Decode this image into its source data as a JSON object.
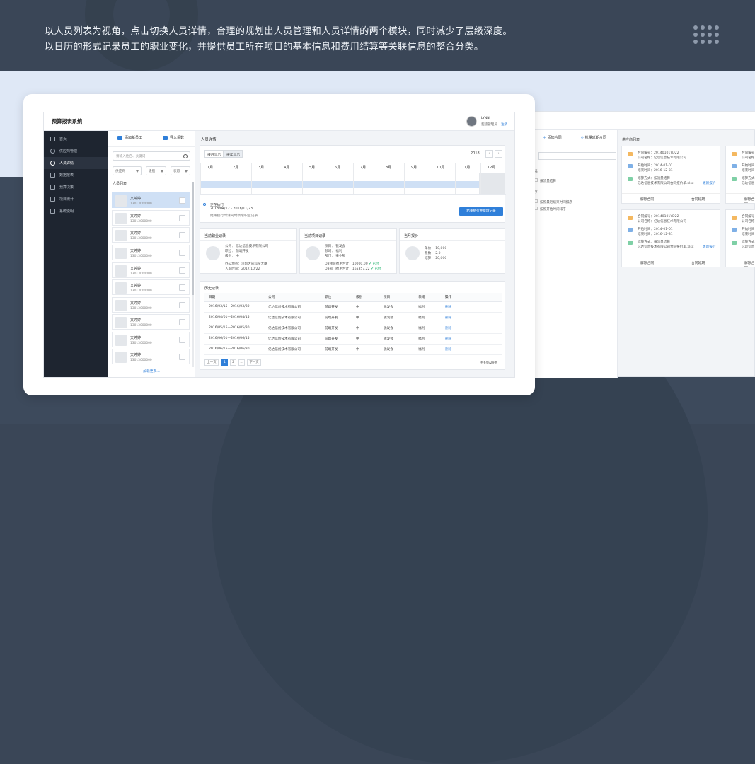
{
  "intro": {
    "line1": "以人员列表为视角，点击切换人员详情，合理的规划出人员管理和人员详情的两个模块，同时减少了层级深度。",
    "line2": "以日历的形式记录员工的职业变化，并提供员工所在项目的基本信息和费用结算等关联信息的整合分类。"
  },
  "colors": {
    "accent": "#2f7fd9",
    "selected_row": "#cfe0f5",
    "sidebar": "#1e2530",
    "band": "#dfe8f6",
    "dark_bg": "#3a4657"
  },
  "app": {
    "title": "预算报表系统",
    "user": {
      "name": "LYNN",
      "role": "超级管理员",
      "link": "注销"
    }
  },
  "sidebar": {
    "items": [
      {
        "label": "首页",
        "icon": "home-icon"
      },
      {
        "label": "供应商管理",
        "icon": "supplier-icon"
      },
      {
        "label": "人员详情",
        "icon": "person-icon"
      },
      {
        "label": "数据报表",
        "icon": "report-icon"
      },
      {
        "label": "预算决策",
        "icon": "budget-icon"
      },
      {
        "label": "项目统计",
        "icon": "project-icon"
      },
      {
        "label": "系统说明",
        "icon": "doc-icon"
      }
    ]
  },
  "list": {
    "add_label": "添加新员工",
    "import_label": "导入系数",
    "search_placeholder": "请输入姓名、关键词",
    "filters": [
      "供应商",
      "级别",
      "状态"
    ],
    "caption": "人员列表",
    "people": [
      {
        "name": "文婷婷",
        "phone": "13013000000"
      },
      {
        "name": "文婷婷",
        "phone": "13013000000"
      },
      {
        "name": "文婷婷",
        "phone": "13013000000"
      },
      {
        "name": "文婷婷",
        "phone": "13013000000"
      },
      {
        "name": "文婷婷",
        "phone": "13013000000"
      },
      {
        "name": "文婷婷",
        "phone": "13013000000"
      },
      {
        "name": "文婷婷",
        "phone": "13013000000"
      },
      {
        "name": "文婷婷",
        "phone": "13013000000"
      },
      {
        "name": "文婷婷",
        "phone": "13013000000"
      },
      {
        "name": "文婷婷",
        "phone": "13013000000"
      }
    ],
    "load_more": "加载更多..."
  },
  "detail": {
    "title": "人员详情",
    "tabs": [
      "按月显示",
      "按年显示"
    ],
    "year": "2018",
    "months": [
      "1月",
      "2月",
      "3月",
      "4月",
      "5月",
      "6月",
      "7月",
      "8月",
      "9月",
      "10月",
      "11月",
      "12月"
    ],
    "event": {
      "status": "正在执行",
      "range": "2018/04/12 - 2018/11/23",
      "note": "结束执行时请同时新增职业记录",
      "button": "结束执行并新增记录"
    }
  },
  "career": {
    "title": "当前职业记录",
    "company": "公司：   亿达信息技术有限公司",
    "position": "职位：   前端开发",
    "level": "级别：   中",
    "office": "办公地点：深圳大族科技大厦",
    "join": "入职时间：2017/10/22"
  },
  "project": {
    "title": "当前项目记录",
    "project": "项目：   锐发会",
    "domain": "领域：   福利",
    "dept": "部门：   事业部",
    "q3_dept_label": "Q3领域费用合计：",
    "q3_dept_value": "10000.00",
    "q3_dept_status": "已付",
    "q3_all_label": "Q3部门费用合计：",
    "q3_all_value": "165357.22",
    "q3_all_status": "已付"
  },
  "quote": {
    "title": "当月报价",
    "price": "单价：   10,000",
    "coef": "系数：   2.0",
    "settle": "结算：   20,000"
  },
  "history": {
    "title": "历史记录",
    "columns": [
      "日期",
      "公司",
      "职位",
      "级别",
      "项目",
      "领域",
      "操作"
    ],
    "rows": [
      [
        "2016/03/15—2016/03/30",
        "亿达信创技术有限公司",
        "前端开发",
        "中",
        "锐发会",
        "福利",
        "删除"
      ],
      [
        "2016/04/01—2016/04/15",
        "亿达信创技术有限公司",
        "前端开发",
        "中",
        "锐发会",
        "福利",
        "删除"
      ],
      [
        "2016/05/15—2016/05/30",
        "亿达信创技术有限公司",
        "前端开发",
        "中",
        "锐发会",
        "福利",
        "删除"
      ],
      [
        "2016/06/01—2016/06/15",
        "亿达信创技术有限公司",
        "前端开发",
        "中",
        "锐发会",
        "福利",
        "删除"
      ],
      [
        "2016/06/15—2016/06/30",
        "亿达信创技术有限公司",
        "前端开发",
        "中",
        "锐发会",
        "福利",
        "删除"
      ]
    ],
    "pager": {
      "prev": "上一页",
      "pages": [
        "1",
        "2",
        "..."
      ],
      "next": "下一页",
      "total": "共6页/29条"
    }
  },
  "secondary": {
    "add_contract": "添加合同",
    "batch_contract": "批量延期合同",
    "list_title": "供应商列表",
    "filters": [
      "按流量结算",
      "按照最近结束时间排序",
      "按照开始时间排序"
    ],
    "filter_caption_1": "选",
    "filter_caption_2": "序",
    "cards": [
      {
        "no": "合同编号：20140101YD22",
        "company": "公司名称：亿达信息技术有限公司",
        "start": "开始时间：2014-01-01",
        "end": "结束时间：2016-12-31",
        "mode": "结算方式：按流量结算",
        "file": "亿达信息技术有限公司合同报价单.xlsx",
        "update": "更新报价",
        "del": "解除合同",
        "ext": "合同延期"
      },
      {
        "no": "合同编号：20140101YD22",
        "company": "公司名称：亿达信息技术有限公司",
        "start": "开始时间：2014-01-01",
        "end": "结束时间：2016-12-31",
        "mode": "结算方式：按流量结算",
        "file": "亿达信息技术有限公司合同报价单.xlsx",
        "update": "更新报价",
        "del": "解除合同",
        "ext": "合同延期"
      }
    ],
    "partial_cards": [
      {
        "no": "合同编号",
        "company": "公司名称",
        "start": "开始时间",
        "end": "结束时间",
        "mode": "结算方式",
        "file": "亿达信息",
        "del": "解除合同"
      },
      {
        "no": "合同编号",
        "company": "公司名称",
        "start": "开始时间",
        "end": "结束时间",
        "mode": "结算方式",
        "file": "亿达信息",
        "del": "解除合同"
      }
    ]
  }
}
